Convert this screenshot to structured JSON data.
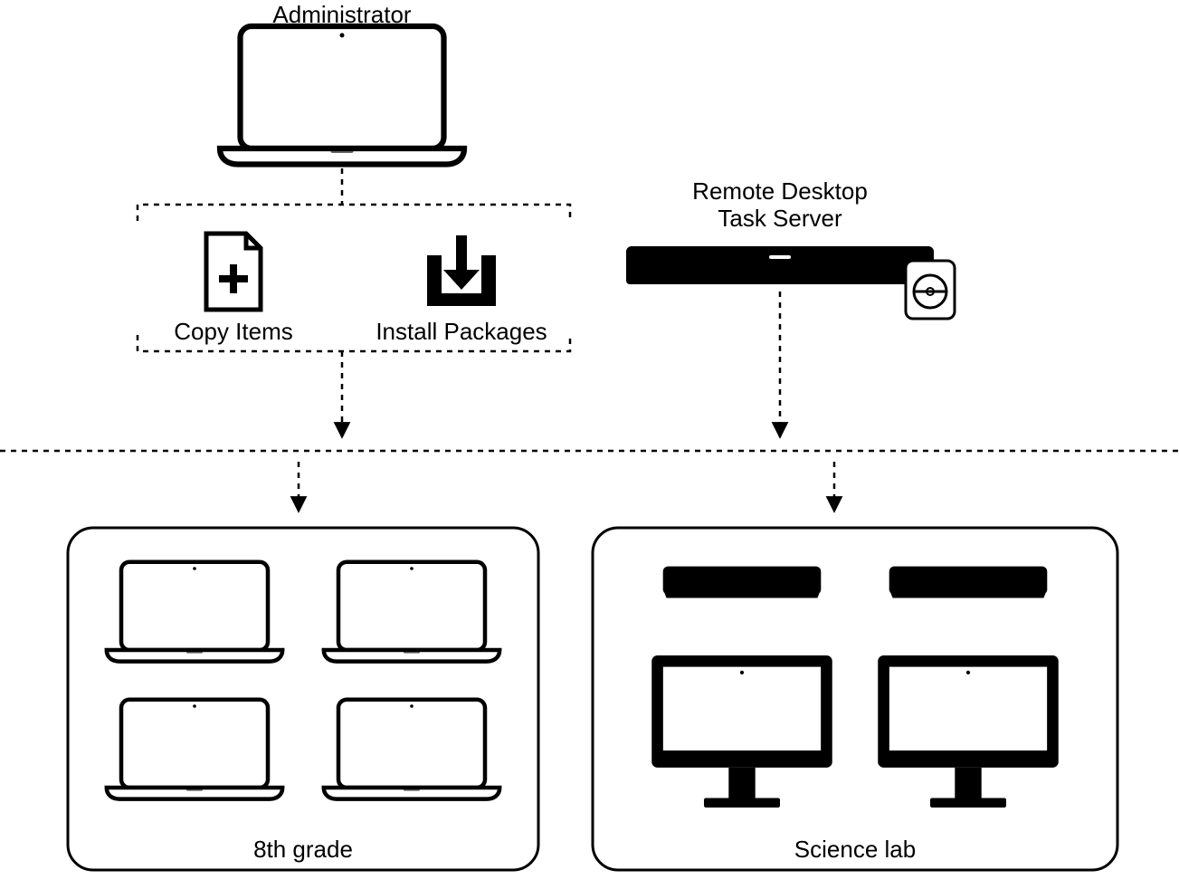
{
  "labels": {
    "administrator": "Administrator",
    "copy_items": "Copy Items",
    "install_packages": "Install Packages",
    "remote_desktop_line1": "Remote Desktop",
    "remote_desktop_line2": "Task Server",
    "group_left": "8th grade",
    "group_right": "Science lab"
  },
  "icons": {
    "admin": "laptop-icon",
    "copy": "document-plus-icon",
    "install": "download-box-icon",
    "server": "server-rack-icon",
    "disc": "disc-icon",
    "client_laptop": "laptop-icon",
    "mini": "mac-mini-icon",
    "display": "desktop-display-icon"
  }
}
